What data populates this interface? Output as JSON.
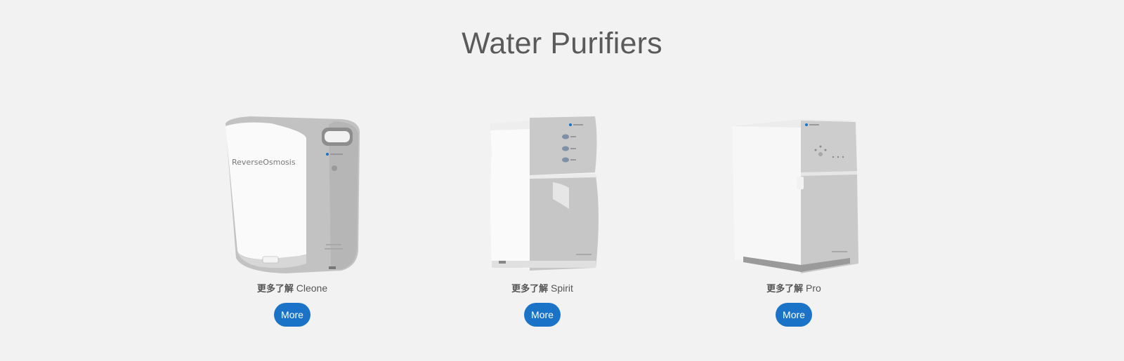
{
  "page": {
    "title": "Water Purifiers"
  },
  "products": [
    {
      "caption_cn": "更多了解",
      "name": "Cleone",
      "button": "More",
      "device_label": "ReverseOsmosis"
    },
    {
      "caption_cn": "更多了解",
      "name": "Spirit",
      "button": "More"
    },
    {
      "caption_cn": "更多了解",
      "name": "Pro",
      "button": "More"
    }
  ],
  "colors": {
    "background": "#f2f2f2",
    "button": "#1a73c6",
    "title": "#5a5a5a"
  }
}
